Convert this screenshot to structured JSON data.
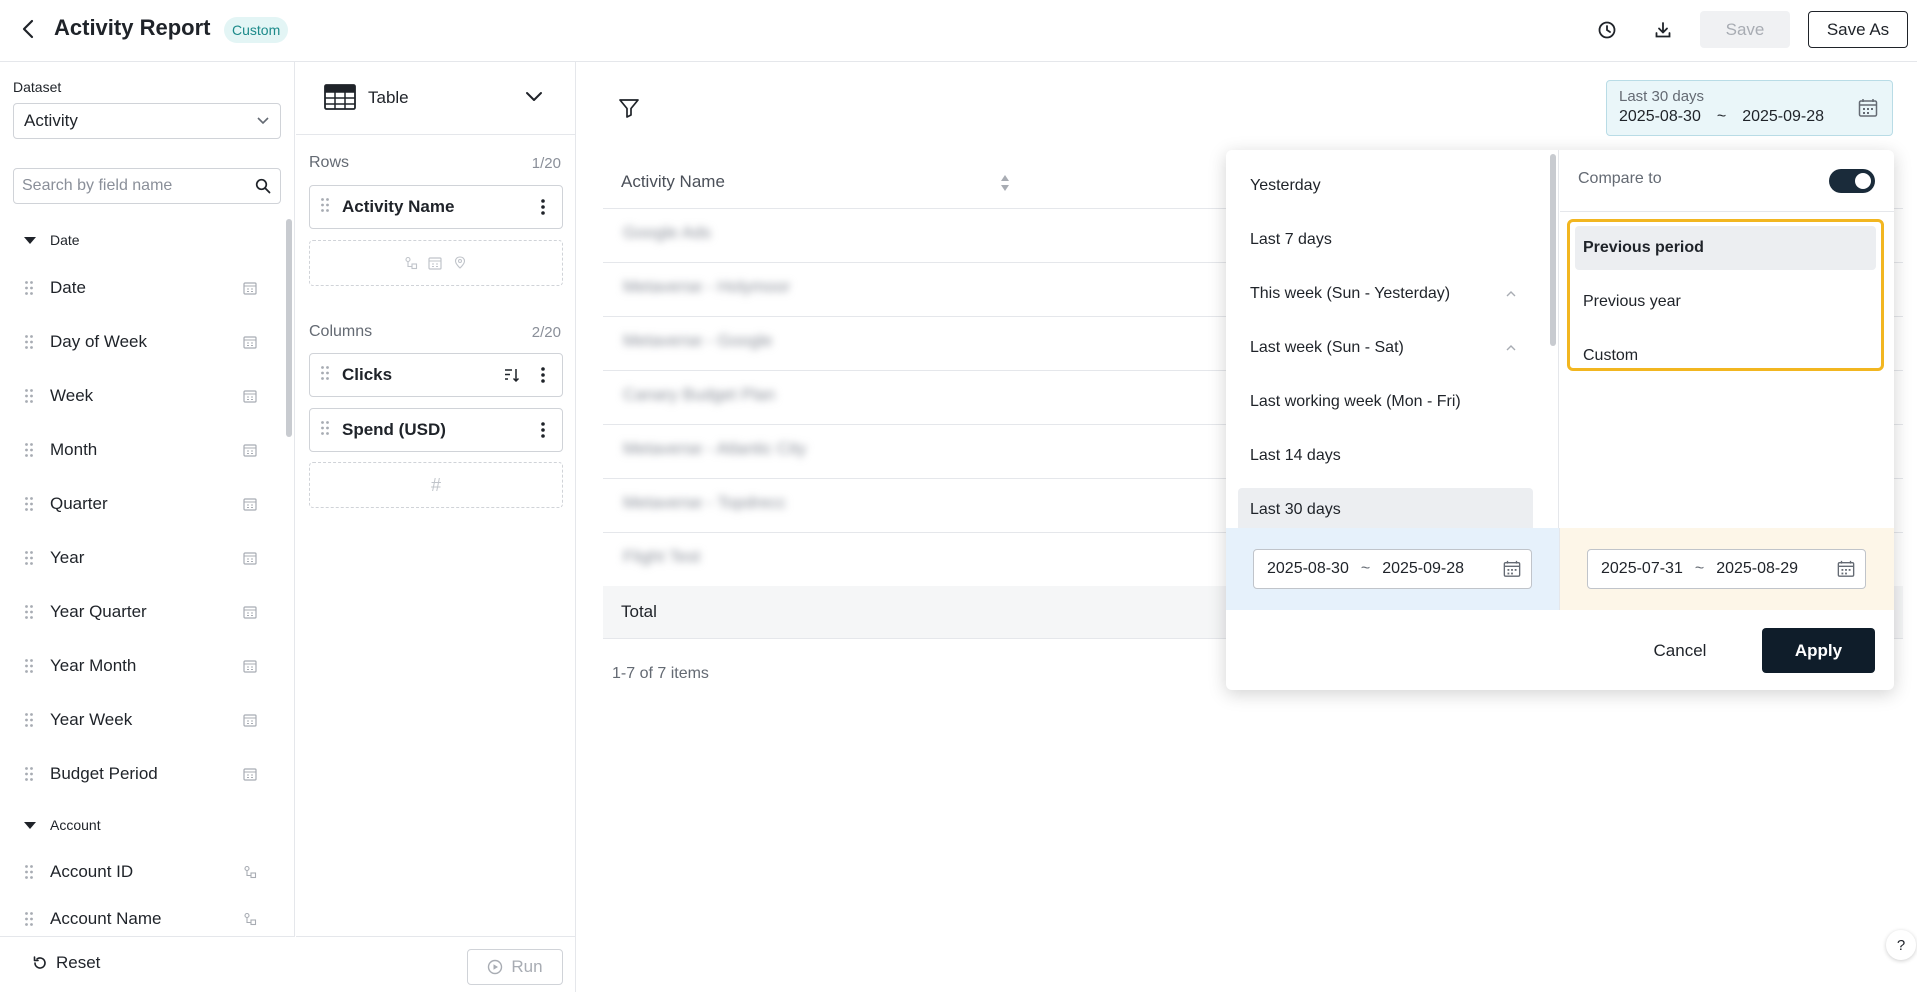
{
  "header": {
    "title": "Activity Report",
    "badge": "Custom",
    "save_label": "Save",
    "save_as_label": "Save As"
  },
  "left_panel": {
    "dataset_label": "Dataset",
    "dataset_value": "Activity",
    "search_placeholder": "Search by field name",
    "groups": [
      {
        "name": "Date",
        "items": [
          "Date",
          "Day of Week",
          "Week",
          "Month",
          "Quarter",
          "Year",
          "Year Quarter",
          "Year Month",
          "Year Week",
          "Budget Period"
        ]
      },
      {
        "name": "Account",
        "items": [
          "Account ID",
          "Account Name"
        ]
      }
    ],
    "reset_label": "Reset"
  },
  "config_panel": {
    "viz_type": "Table",
    "rows_label": "Rows",
    "rows_count": "1/20",
    "rows": [
      "Activity Name"
    ],
    "columns_label": "Columns",
    "columns_count": "2/20",
    "columns": [
      "Clicks",
      "Spend (USD)"
    ],
    "run_label": "Run"
  },
  "table": {
    "header": "Activity Name",
    "rows": [
      "Google Ads",
      "Metaverse - Holymoor",
      "Metaverse - Google",
      "Canary Budget Plan",
      "Metaverse - Atlantic City",
      "Metaverse - Topdrecc",
      "Flight Test"
    ],
    "total_label": "Total",
    "pagination": "1-7 of 7 items"
  },
  "date_trigger": {
    "preset": "Last 30 days",
    "start": "2025-08-30",
    "separator": "~",
    "end": "2025-09-28"
  },
  "date_picker": {
    "presets": [
      "Yesterday",
      "Last 7 days",
      "This week (Sun - Yesterday)",
      "Last week (Sun - Sat)",
      "Last working week (Mon - Fri)",
      "Last 14 days",
      "Last 30 days"
    ],
    "selected_preset": "Last 30 days",
    "compare_label": "Compare to",
    "compare_enabled": true,
    "compare_options": [
      "Previous period",
      "Previous year",
      "Custom"
    ],
    "selected_compare": "Previous period",
    "current_range": {
      "start": "2025-08-30",
      "end": "2025-09-28"
    },
    "compare_range": {
      "start": "2025-07-31",
      "end": "2025-08-29"
    },
    "separator": "~",
    "cancel_label": "Cancel",
    "apply_label": "Apply"
  },
  "help_label": "?",
  "colors": {
    "primary_dark": "#0f1d2a",
    "badge_bg": "#e3f5f5",
    "badge_text": "#1c8a8a",
    "highlight_border": "#f2b620",
    "current_range_bg": "#e6f1fb",
    "compare_range_bg": "#fdf6e8"
  }
}
